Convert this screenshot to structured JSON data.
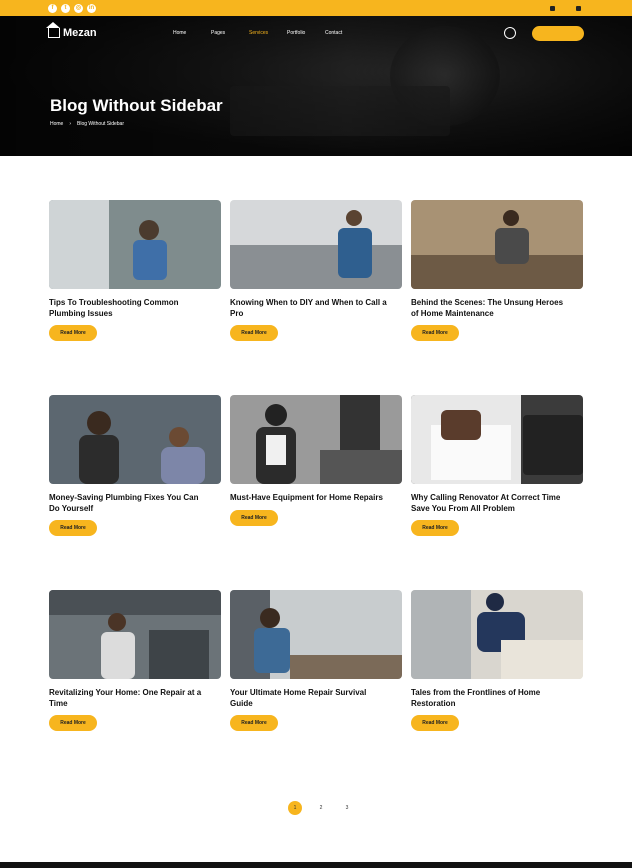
{
  "topbar": {
    "social_icons": [
      "facebook-icon",
      "twitter-icon",
      "instagram-icon",
      "linkedin-icon"
    ],
    "address": "",
    "email": ""
  },
  "nav": {
    "brand": "Mezan",
    "menu": [
      "Home",
      "Pages",
      "Services",
      "Portfolio",
      "Contact"
    ],
    "call_label": "",
    "call_number": "",
    "quote_label": ""
  },
  "hero": {
    "title": "Blog Without Sidebar",
    "crumb_home": "Home",
    "crumb_current": "Blog Without Sidebar"
  },
  "posts": [
    {
      "meta": "",
      "title": "Tips To Troubleshooting Common Plumbing Issues",
      "excerpt": "",
      "btn": "Read More",
      "img": "#7f8c8d"
    },
    {
      "meta": "",
      "title": "Knowing When to DIY and When to Call a Pro",
      "excerpt": "",
      "btn": "Read More",
      "img": "#9aa3a8"
    },
    {
      "meta": "",
      "title": "Behind the Scenes: The Unsung Heroes of Home Maintenance",
      "excerpt": "",
      "btn": "Read More",
      "img": "#8b7a66"
    },
    {
      "meta": "",
      "title": "Money-Saving Plumbing Fixes You Can Do Yourself",
      "excerpt": "",
      "btn": "Read More",
      "img": "#5c6770"
    },
    {
      "meta": "",
      "title": "Must-Have Equipment for Home Repairs",
      "excerpt": "",
      "btn": "Read More",
      "img": "#6e6e6e"
    },
    {
      "meta": "",
      "title": "Why Calling Renovator At Correct Time Save You From All Problem",
      "excerpt": "",
      "btn": "Read More",
      "img": "#4f4f4f"
    },
    {
      "meta": "",
      "title": "Revitalizing Your Home: One Repair at a Time",
      "excerpt": "",
      "btn": "Read More",
      "img": "#6b7378"
    },
    {
      "meta": "",
      "title": "Your Ultimate Home Repair Survival Guide",
      "excerpt": "",
      "btn": "Read More",
      "img": "#8a8f93"
    },
    {
      "meta": "",
      "title": "Tales from the Frontlines of Home Restoration",
      "excerpt": "",
      "btn": "Read More",
      "img": "#b9b7b0"
    }
  ],
  "pagination": [
    "1",
    "2",
    "3"
  ],
  "colors": {
    "accent": "#f7b51e",
    "dark": "#111111"
  }
}
